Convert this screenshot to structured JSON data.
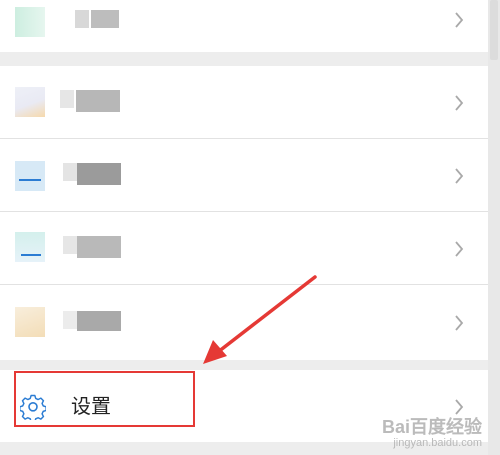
{
  "menu": {
    "items": [
      {
        "key": "item-1",
        "label": ""
      },
      {
        "key": "item-2",
        "label": ""
      },
      {
        "key": "item-3",
        "label": ""
      },
      {
        "key": "item-4",
        "label": ""
      },
      {
        "key": "item-5",
        "label": ""
      },
      {
        "key": "settings",
        "label": "设置"
      }
    ]
  },
  "icons": {
    "settings": "gear-icon",
    "chevron": "chevron-right-icon"
  },
  "colors": {
    "accent_blue": "#2b7cd3",
    "highlight_red": "#e53935",
    "arrow_red": "#e53935"
  },
  "watermark": {
    "main": "Bai百度经验",
    "sub": "jingyan.baidu.com"
  }
}
